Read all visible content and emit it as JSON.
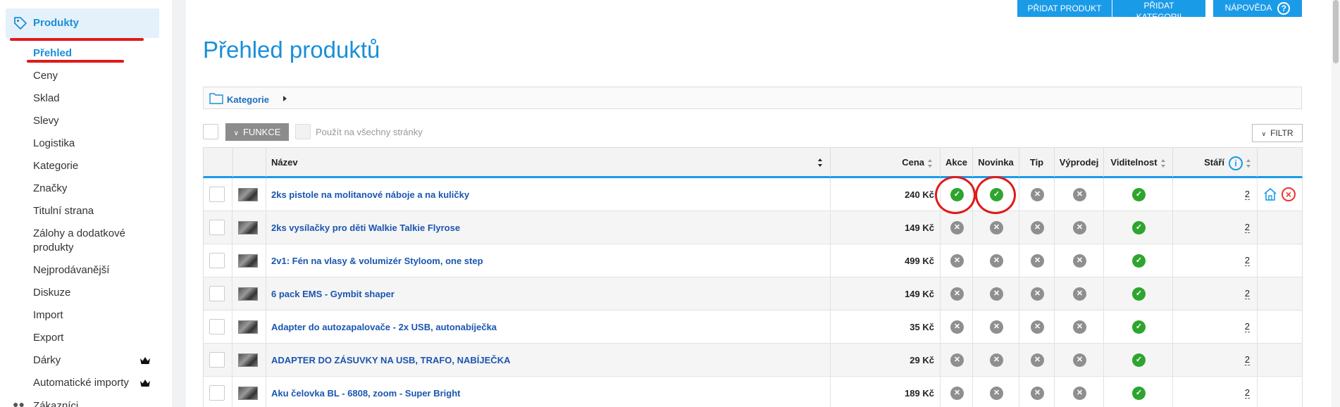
{
  "sidebar": {
    "section_label": "Produkty",
    "items": [
      {
        "label": "Přehled",
        "active": true
      },
      {
        "label": "Ceny"
      },
      {
        "label": "Sklad"
      },
      {
        "label": "Slevy"
      },
      {
        "label": "Logistika"
      },
      {
        "label": "Kategorie"
      },
      {
        "label": "Značky"
      },
      {
        "label": "Titulní strana"
      },
      {
        "label": "Zálohy a dodatkové"
      },
      {
        "label": "produkty"
      },
      {
        "label": "Nejprodávanější"
      },
      {
        "label": "Diskuze"
      },
      {
        "label": "Import"
      },
      {
        "label": "Export"
      },
      {
        "label": "Dárky",
        "crown": true
      },
      {
        "label": "Automatické importy",
        "crown": true
      }
    ],
    "partial_item": "Zákazníci"
  },
  "toolbar": {
    "add_product": "PŘIDAT PRODUKT",
    "add_category": "PŘIDAT KATEGORII",
    "help": "NÁPOVĚDA",
    "help_icon": "?"
  },
  "page_title": "Přehled produktů",
  "breadcrumb": {
    "label": "Kategorie"
  },
  "bulk": {
    "functions_label": "FUNKCE",
    "apply_all_label": "Použít na všechny stránky",
    "filter_label": "FILTR"
  },
  "table": {
    "headers": {
      "name": "Název",
      "price": "Cena",
      "akce": "Akce",
      "novinka": "Novinka",
      "tip": "Tip",
      "vyprodej": "Výprodej",
      "visibility": "Viditelnost",
      "age": "Stáří",
      "age_info": "i"
    },
    "rows": [
      {
        "name": "2ks pistole na molitanové náboje a na kuličky",
        "price": "240 Kč",
        "akce": true,
        "novinka": true,
        "tip": false,
        "vyprodej": false,
        "visible": true,
        "age": "2"
      },
      {
        "name": "2ks vysílačky pro děti Walkie Talkie Flyrose",
        "price": "149 Kč",
        "akce": false,
        "novinka": false,
        "tip": false,
        "vyprodej": false,
        "visible": true,
        "age": "2"
      },
      {
        "name": "2v1: Fén na vlasy & volumizér Styloom, one step",
        "price": "499 Kč",
        "akce": false,
        "novinka": false,
        "tip": false,
        "vyprodej": false,
        "visible": true,
        "age": "2"
      },
      {
        "name": "6 pack EMS - Gymbit shaper",
        "price": "149 Kč",
        "akce": false,
        "novinka": false,
        "tip": false,
        "vyprodej": false,
        "visible": true,
        "age": "2"
      },
      {
        "name": "Adapter do autozapalovače - 2x USB, autonabíječka",
        "price": "35 Kč",
        "akce": false,
        "novinka": false,
        "tip": false,
        "vyprodej": false,
        "visible": true,
        "age": "2"
      },
      {
        "name": "ADAPTER DO ZÁSUVKY NA USB, TRAFO, NABÍJEČKA",
        "price": "29 Kč",
        "akce": false,
        "novinka": false,
        "tip": false,
        "vyprodej": false,
        "visible": true,
        "age": "2"
      },
      {
        "name": "Aku čelovka BL - 6808, zoom - Super Bright",
        "price": "189 Kč",
        "akce": false,
        "novinka": false,
        "tip": false,
        "vyprodej": false,
        "visible": true,
        "age": "2"
      }
    ]
  },
  "colors": {
    "accent": "#1a9be8",
    "ok": "#2ea52e",
    "off": "#8f8f8f",
    "annotation": "#e01a1a"
  }
}
